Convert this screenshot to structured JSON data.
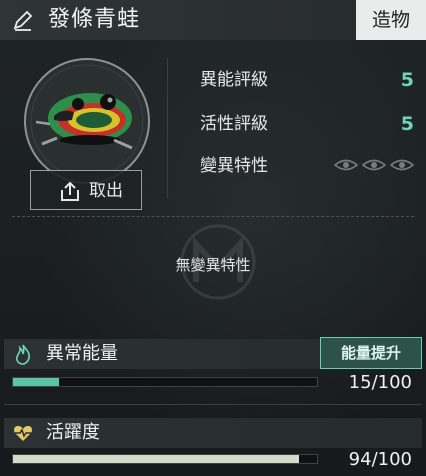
{
  "header": {
    "title": "發條青蛙",
    "type_badge": "造物",
    "icon": "pencil-icon"
  },
  "item": {
    "take_out_label": "取出",
    "take_out_icon": "upload-icon"
  },
  "stats": [
    {
      "label": "異能評級",
      "value": "5"
    },
    {
      "label": "活性評級",
      "value": "5"
    },
    {
      "label": "變異特性",
      "value": "",
      "icons": [
        "eye-icon",
        "eye-icon",
        "eye-icon"
      ]
    }
  ],
  "mutation": {
    "empty_text": "無變異特性"
  },
  "energy": {
    "label": "異常能量",
    "icon": "flame-icon",
    "boost_label": "能量提升",
    "current": 15,
    "max": 100,
    "display": "15/100",
    "color": "#5cc4a6"
  },
  "activity": {
    "label": "活躍度",
    "icon": "heartbeat-icon",
    "current": 94,
    "max": 100,
    "display": "94/100",
    "color": "#d9d9c8"
  },
  "colors": {
    "accent": "#6fd4bb"
  }
}
